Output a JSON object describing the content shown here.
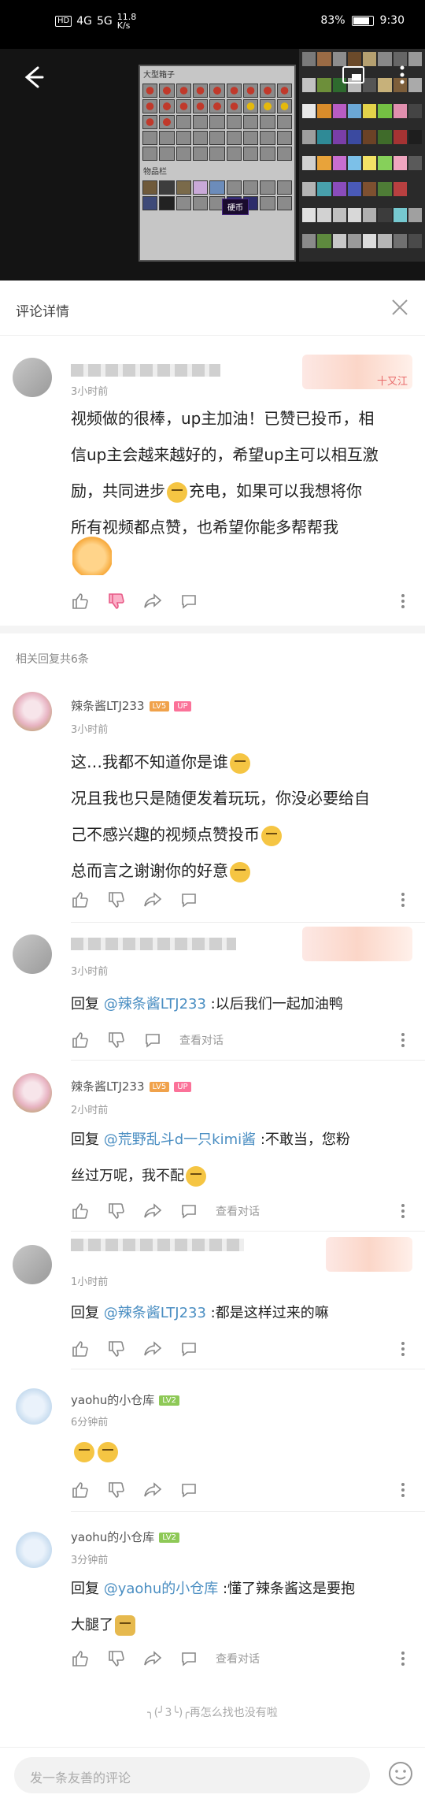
{
  "status_bar": {
    "network": "HD",
    "signal_1": "4G",
    "signal_2": "5G",
    "speed": "11.8\nK/s",
    "battery": "83%",
    "time": "9:30"
  },
  "video": {
    "panel_title": "大型箱子",
    "inventory_label": "物品栏",
    "tooltip": "硬币"
  },
  "header": {
    "title": "评论详情"
  },
  "main_comment": {
    "time": "3小时前",
    "body_1": "视频做的很棒，up主加油！已赞已投币，相",
    "body_2": "信up主会越来越好的，希望up主可以相互激",
    "body_3": "励，共同进步",
    "body_3b": "充电，如果可以我想将你",
    "body_4": "所有视频都点赞，也希望你能多帮帮我",
    "badge_text": "十又江"
  },
  "related_count": "相关回复共6条",
  "replies": [
    {
      "name": "辣条酱LTJ233",
      "level": "LV5",
      "up": "UP",
      "time": "3小时前",
      "line_1": "这…我都不知道你是谁",
      "line_2": "况且我也只是随便发着玩玩，你没必要给自",
      "line_3": "己不感兴趣的视频点赞投币",
      "line_4": "总而言之谢谢你的好意"
    },
    {
      "time": "3小时前",
      "prefix": "回复 ",
      "mention": "@辣条酱LTJ233",
      "rest": " :以后我们一起加油鸭",
      "view": "查看对话"
    },
    {
      "name": "辣条酱LTJ233",
      "level": "LV5",
      "up": "UP",
      "time": "2小时前",
      "prefix": "回复 ",
      "mention": "@荒野乱斗d一只kimi酱",
      "rest": " :不敢当，您粉",
      "line_2": "丝过万呢，我不配",
      "view": "查看对话"
    },
    {
      "time": "1小时前",
      "prefix": "回复 ",
      "mention": "@辣条酱LTJ233",
      "rest": " :都是这样过来的嘛"
    },
    {
      "name": "yaohu的小仓库",
      "level": "LV2",
      "time": "6分钟前"
    },
    {
      "name": "yaohu的小仓库",
      "level": "LV2",
      "time": "3分钟前",
      "prefix": "回复 ",
      "mention": "@yaohu的小仓库",
      "rest": " :懂了辣条酱这是要抱",
      "line_2": "大腿了",
      "view": "查看对话"
    }
  ],
  "end_note": "╮(╯3╰)╭再怎么找也没有啦",
  "input": {
    "placeholder": "发一条友善的评论"
  }
}
